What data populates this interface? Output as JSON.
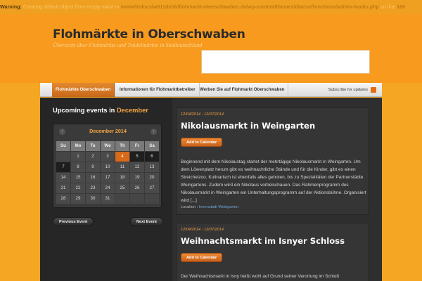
{
  "warning": {
    "label": "Warning:",
    "message": "Creating default object from empty value in",
    "path": "/www/htdocs/w011debb/flohmarkt-oberschwaben.de/wp-content/themes/diarise/functions/admin-hooks.php",
    "suffix": "on line",
    "line": "160"
  },
  "header": {
    "title": "Flohmärkte in Oberschwaben",
    "description": "Übersicht über Flohmärkte und Trödelmärkte in Süddeutschland"
  },
  "nav": {
    "items": [
      {
        "label": "Flohmärkte Oberschwaben",
        "active": true
      },
      {
        "label": "Informationen für Flohmarktbetreiber",
        "active": false
      },
      {
        "label": "Werben Sie auf Flohmarkt Oberschwaben",
        "active": false
      }
    ],
    "subscribe": "Subscribe for updates"
  },
  "sidebar": {
    "upcoming_prefix": "Upcoming events in",
    "upcoming_month": "December"
  },
  "calendar": {
    "title": "December 2014",
    "prev_icon": "‹",
    "next_icon": "›",
    "dow": [
      "Su",
      "Mo",
      "Tu",
      "We",
      "Th",
      "Fr",
      "Sa"
    ],
    "weeks": [
      [
        "",
        "1",
        "2",
        "3",
        "4",
        "5",
        "6"
      ],
      [
        "7",
        "8",
        "9",
        "10",
        "11",
        "12",
        "13"
      ],
      [
        "14",
        "15",
        "16",
        "17",
        "18",
        "19",
        "20"
      ],
      [
        "21",
        "22",
        "23",
        "24",
        "25",
        "26",
        "27"
      ],
      [
        "28",
        "29",
        "30",
        "31",
        "",
        "",
        ""
      ]
    ],
    "today": "4",
    "prev_label": "Previous Event",
    "next_label": "Next Event"
  },
  "posts": [
    {
      "date": "12/04/2014 - 12/07/2014",
      "title": "Nikolausmarkt in Weingarten",
      "button": "Add to Calendar",
      "text": "Beginnend mit dem Nikolaustag startet der mehrtägige Nikolausmarkt in Weingarten. Um dem Löwenplatz herum gibt es weihnachtliche Stände und für die Kinder, gibt es einen Streichelzoo. Kulinarisch ist ebenfalls alles geboten, bis zu Spezialitäten der Partnerstädte Weingartens. Zudem wird ein Nikolaus vorbeischauen. Das Rahmenprogramm des Nikolausmarkt in Weingarten ein Unterhaltungsprogramm auf der Aktionsbühne. Organisiert wird [...]",
      "location_label": "Location :",
      "location": "Innenstadt Weingarten"
    },
    {
      "date": "12/04/2014 - 12/07/2014",
      "title": "Weihnachtsmarkt im Isnyer Schloss",
      "button": "Add to Calendar",
      "text": "Der Weihnachtsmarkt in Isny heißt wohl auf Grund seiner Verortung im Schloß"
    }
  ],
  "colors": {
    "background": "#f5a623",
    "accent": "#f5a443",
    "panel": "#2e2e2e",
    "today": "#d96a1a"
  }
}
